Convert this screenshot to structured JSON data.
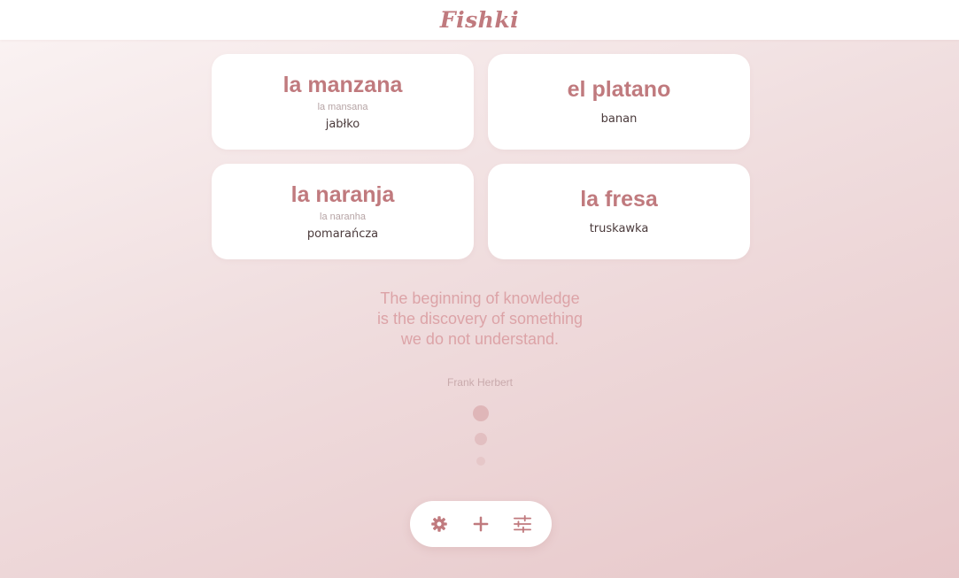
{
  "header": {
    "logo": "Fishki"
  },
  "cards": [
    {
      "word": "la manzana",
      "pronunciation": "la mansana",
      "translation": "jabłko"
    },
    {
      "word": "el platano",
      "pronunciation": "",
      "translation": "banan"
    },
    {
      "word": "la naranja",
      "pronunciation": "la naranha",
      "translation": "pomarańcza"
    },
    {
      "word": "la fresa",
      "pronunciation": "",
      "translation": "truskawka"
    }
  ],
  "quote": {
    "text": "The beginning of knowledge is the discovery of something we do not understand.",
    "author": "Frank Herbert"
  },
  "toolbar": {
    "items": [
      {
        "icon": "gear-icon"
      },
      {
        "icon": "plus-icon"
      },
      {
        "icon": "sliders-icon"
      }
    ]
  },
  "colors": {
    "accent": "#c07a7e",
    "quote": "#dca3a7",
    "text": "#4a3a3b"
  }
}
